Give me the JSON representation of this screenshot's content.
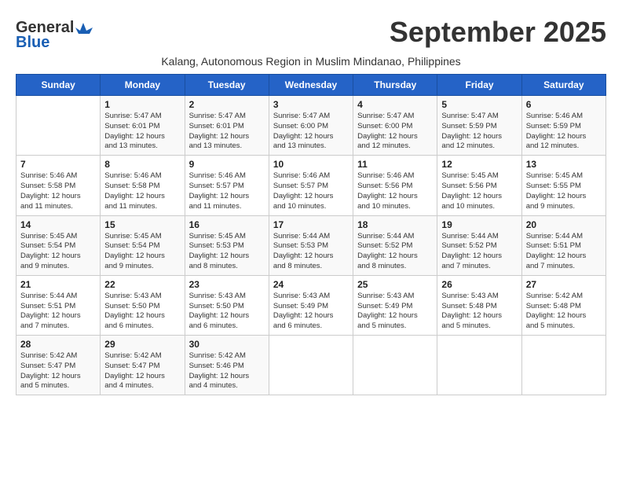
{
  "header": {
    "logo_line1": "General",
    "logo_line2": "Blue",
    "month": "September 2025",
    "subtitle": "Kalang, Autonomous Region in Muslim Mindanao, Philippines"
  },
  "days_of_week": [
    "Sunday",
    "Monday",
    "Tuesday",
    "Wednesday",
    "Thursday",
    "Friday",
    "Saturday"
  ],
  "weeks": [
    [
      {
        "day": "",
        "info": ""
      },
      {
        "day": "1",
        "info": "Sunrise: 5:47 AM\nSunset: 6:01 PM\nDaylight: 12 hours\nand 13 minutes."
      },
      {
        "day": "2",
        "info": "Sunrise: 5:47 AM\nSunset: 6:01 PM\nDaylight: 12 hours\nand 13 minutes."
      },
      {
        "day": "3",
        "info": "Sunrise: 5:47 AM\nSunset: 6:00 PM\nDaylight: 12 hours\nand 13 minutes."
      },
      {
        "day": "4",
        "info": "Sunrise: 5:47 AM\nSunset: 6:00 PM\nDaylight: 12 hours\nand 12 minutes."
      },
      {
        "day": "5",
        "info": "Sunrise: 5:47 AM\nSunset: 5:59 PM\nDaylight: 12 hours\nand 12 minutes."
      },
      {
        "day": "6",
        "info": "Sunrise: 5:46 AM\nSunset: 5:59 PM\nDaylight: 12 hours\nand 12 minutes."
      }
    ],
    [
      {
        "day": "7",
        "info": "Sunrise: 5:46 AM\nSunset: 5:58 PM\nDaylight: 12 hours\nand 11 minutes."
      },
      {
        "day": "8",
        "info": "Sunrise: 5:46 AM\nSunset: 5:58 PM\nDaylight: 12 hours\nand 11 minutes."
      },
      {
        "day": "9",
        "info": "Sunrise: 5:46 AM\nSunset: 5:57 PM\nDaylight: 12 hours\nand 11 minutes."
      },
      {
        "day": "10",
        "info": "Sunrise: 5:46 AM\nSunset: 5:57 PM\nDaylight: 12 hours\nand 10 minutes."
      },
      {
        "day": "11",
        "info": "Sunrise: 5:46 AM\nSunset: 5:56 PM\nDaylight: 12 hours\nand 10 minutes."
      },
      {
        "day": "12",
        "info": "Sunrise: 5:45 AM\nSunset: 5:56 PM\nDaylight: 12 hours\nand 10 minutes."
      },
      {
        "day": "13",
        "info": "Sunrise: 5:45 AM\nSunset: 5:55 PM\nDaylight: 12 hours\nand 9 minutes."
      }
    ],
    [
      {
        "day": "14",
        "info": "Sunrise: 5:45 AM\nSunset: 5:54 PM\nDaylight: 12 hours\nand 9 minutes."
      },
      {
        "day": "15",
        "info": "Sunrise: 5:45 AM\nSunset: 5:54 PM\nDaylight: 12 hours\nand 9 minutes."
      },
      {
        "day": "16",
        "info": "Sunrise: 5:45 AM\nSunset: 5:53 PM\nDaylight: 12 hours\nand 8 minutes."
      },
      {
        "day": "17",
        "info": "Sunrise: 5:44 AM\nSunset: 5:53 PM\nDaylight: 12 hours\nand 8 minutes."
      },
      {
        "day": "18",
        "info": "Sunrise: 5:44 AM\nSunset: 5:52 PM\nDaylight: 12 hours\nand 8 minutes."
      },
      {
        "day": "19",
        "info": "Sunrise: 5:44 AM\nSunset: 5:52 PM\nDaylight: 12 hours\nand 7 minutes."
      },
      {
        "day": "20",
        "info": "Sunrise: 5:44 AM\nSunset: 5:51 PM\nDaylight: 12 hours\nand 7 minutes."
      }
    ],
    [
      {
        "day": "21",
        "info": "Sunrise: 5:44 AM\nSunset: 5:51 PM\nDaylight: 12 hours\nand 7 minutes."
      },
      {
        "day": "22",
        "info": "Sunrise: 5:43 AM\nSunset: 5:50 PM\nDaylight: 12 hours\nand 6 minutes."
      },
      {
        "day": "23",
        "info": "Sunrise: 5:43 AM\nSunset: 5:50 PM\nDaylight: 12 hours\nand 6 minutes."
      },
      {
        "day": "24",
        "info": "Sunrise: 5:43 AM\nSunset: 5:49 PM\nDaylight: 12 hours\nand 6 minutes."
      },
      {
        "day": "25",
        "info": "Sunrise: 5:43 AM\nSunset: 5:49 PM\nDaylight: 12 hours\nand 5 minutes."
      },
      {
        "day": "26",
        "info": "Sunrise: 5:43 AM\nSunset: 5:48 PM\nDaylight: 12 hours\nand 5 minutes."
      },
      {
        "day": "27",
        "info": "Sunrise: 5:42 AM\nSunset: 5:48 PM\nDaylight: 12 hours\nand 5 minutes."
      }
    ],
    [
      {
        "day": "28",
        "info": "Sunrise: 5:42 AM\nSunset: 5:47 PM\nDaylight: 12 hours\nand 5 minutes."
      },
      {
        "day": "29",
        "info": "Sunrise: 5:42 AM\nSunset: 5:47 PM\nDaylight: 12 hours\nand 4 minutes."
      },
      {
        "day": "30",
        "info": "Sunrise: 5:42 AM\nSunset: 5:46 PM\nDaylight: 12 hours\nand 4 minutes."
      },
      {
        "day": "",
        "info": ""
      },
      {
        "day": "",
        "info": ""
      },
      {
        "day": "",
        "info": ""
      },
      {
        "day": "",
        "info": ""
      }
    ]
  ]
}
